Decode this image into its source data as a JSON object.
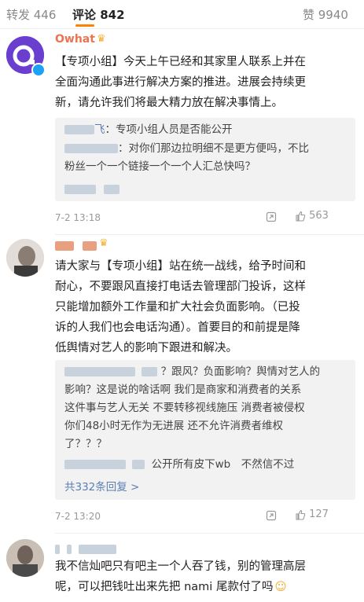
{
  "tabs": {
    "reposts": "转发 446",
    "comments": "评论 842",
    "likes": "赞 9940"
  },
  "comments": [
    {
      "name": "Owhat",
      "text": "【专项小组】今天上午已经和其家里人联系上并在全面沟通此事进行解决方案的推进。进展会持续更新，请允许我们将最大精力放在解决事情上。",
      "lines": [
        "【专项小组】今天上午已经和其家里人联系上并在",
        "全面沟通此事进行解决方案的推进。进展会持续更",
        "新，请允许我们将最大精力放在解决事情上。"
      ],
      "replies": [
        {
          "user": "飞",
          "text": "：专项小组人员是否能公开"
        },
        {
          "user": "",
          "text": "：对你们那边拉明细不是更方便吗，不比",
          "cont": "粉丝一个一个链接一个一个人汇总快吗？"
        }
      ],
      "time": "7-2 13:18",
      "likes": "563"
    },
    {
      "name": "",
      "lines": [
        "请大家与【专项小组】站在统一战线，给予时间和",
        "耐心，不要跟风直接打电话去管理部门投诉，这样",
        "只能增加额外工作量和扩大社会负面影响。（已投",
        "诉的人我们也会电话沟通）。首要目的和前提是降",
        "低舆情对艺人的影响下跟进和解决。"
      ],
      "reply_lines": [
        "？跟风？负面影响？舆情对艺人的",
        "影响？这是说的啥话啊 我们是商家和消费者的关系",
        "这件事与艺人无关 不要转移视线施压 消费者被侵权",
        "你们48小时无作为无进展 还不允许消费者维权",
        "了？？？"
      ],
      "reply2": "公开所有皮下wb　不然信不过",
      "more": "共332条回复 >",
      "time": "7-2 13:20",
      "likes": "127"
    },
    {
      "lines": [
        "我不信灿吧只有吧主一个人吞了钱，别的管理高层",
        "呢，可以把钱吐出来先把 nami 尾款付了吗"
      ]
    }
  ]
}
